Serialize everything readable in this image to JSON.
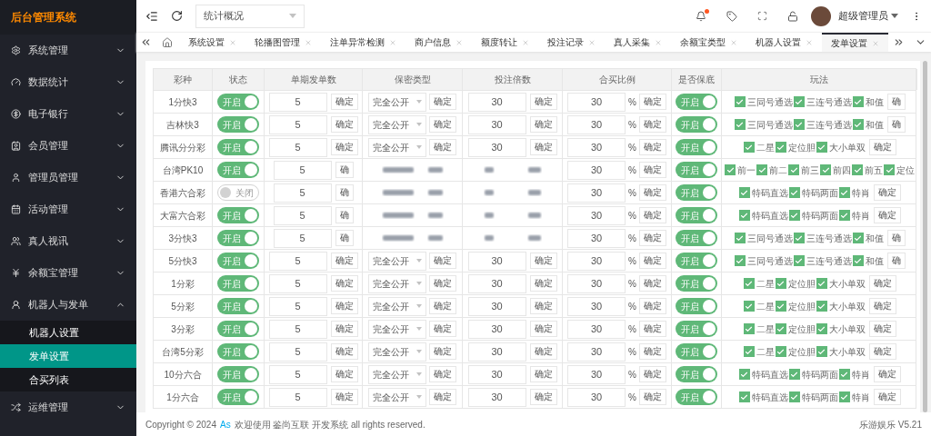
{
  "logo": "后台管理系统",
  "sidebar": {
    "items": [
      {
        "label": "系统管理",
        "expanded": false
      },
      {
        "label": "数据统计",
        "expanded": false
      },
      {
        "label": "电子银行",
        "expanded": false
      },
      {
        "label": "会员管理",
        "expanded": false
      },
      {
        "label": "管理员管理",
        "expanded": false
      },
      {
        "label": "活动管理",
        "expanded": false
      },
      {
        "label": "真人视讯",
        "expanded": false
      },
      {
        "label": "余额宝管理",
        "expanded": false
      },
      {
        "label": "机器人与发单",
        "expanded": true,
        "children": [
          {
            "label": "机器人设置",
            "selected": false
          },
          {
            "label": "发单设置",
            "selected": true
          },
          {
            "label": "合买列表",
            "selected": false
          }
        ]
      },
      {
        "label": "运维管理",
        "expanded": false
      }
    ]
  },
  "topbar": {
    "select": "统计概况",
    "user": "超级管理员",
    "notification_dot": true
  },
  "tabs": [
    {
      "label": "系统设置",
      "selected": false
    },
    {
      "label": "轮播图管理",
      "selected": false
    },
    {
      "label": "注单异常检测",
      "selected": false
    },
    {
      "label": "商户信息",
      "selected": false
    },
    {
      "label": "额度转让",
      "selected": false
    },
    {
      "label": "投注记录",
      "selected": false
    },
    {
      "label": "真人采集",
      "selected": false
    },
    {
      "label": "余额宝类型",
      "selected": false
    },
    {
      "label": "机器人设置",
      "selected": false
    },
    {
      "label": "发单设置",
      "selected": true
    }
  ],
  "table": {
    "columns": [
      "彩种",
      "状态",
      "单期发单数",
      "保密类型",
      "投注倍数",
      "合买比例",
      "是否保底",
      "玩法"
    ],
    "rows": [
      {
        "name": "1分快3",
        "status": {
          "on": true,
          "label": "开启"
        },
        "qty": "5",
        "qty_button": "确定",
        "blurred": false,
        "secrecy": "完全公开",
        "secrecy_button": "确定",
        "multiple": "30",
        "multiple_button": "确定",
        "ratio": "30",
        "ratio_unit": "%",
        "ratio_button": "确定",
        "guarantee": {
          "on": true,
          "label": "开启"
        },
        "plays": [
          {
            "label": "三同号通选",
            "checked": true
          },
          {
            "label": "三连号通选",
            "checked": true
          },
          {
            "label": "和值",
            "checked": true
          }
        ],
        "plays_button": "确"
      },
      {
        "name": "吉林快3",
        "status": {
          "on": true,
          "label": "开启"
        },
        "qty": "5",
        "qty_button": "确定",
        "blurred": false,
        "secrecy": "完全公开",
        "secrecy_button": "确定",
        "multiple": "30",
        "multiple_button": "确定",
        "ratio": "30",
        "ratio_unit": "%",
        "ratio_button": "确定",
        "guarantee": {
          "on": true,
          "label": "开启"
        },
        "plays": [
          {
            "label": "三同号通选",
            "checked": true
          },
          {
            "label": "三连号通选",
            "checked": true
          },
          {
            "label": "和值",
            "checked": true
          }
        ],
        "plays_button": "确"
      },
      {
        "name": "腾讯分分彩",
        "status": {
          "on": true,
          "label": "开启"
        },
        "qty": "5",
        "qty_button": "确定",
        "blurred": false,
        "secrecy": "完全公开",
        "secrecy_button": "确定",
        "multiple": "30",
        "multiple_button": "确定",
        "ratio": "30",
        "ratio_unit": "%",
        "ratio_button": "确定",
        "guarantee": {
          "on": true,
          "label": "开启"
        },
        "plays": [
          {
            "label": "二星",
            "checked": true
          },
          {
            "label": "定位胆",
            "checked": true
          },
          {
            "label": "大小单双",
            "checked": true
          }
        ],
        "plays_button": "确定"
      },
      {
        "name": "台湾PK10",
        "status": {
          "on": true,
          "label": "开启"
        },
        "qty": "5",
        "qty_button": "确",
        "blurred": true,
        "ratio": "30",
        "ratio_unit": "%",
        "ratio_button": "确定",
        "guarantee": {
          "on": true,
          "label": "开启"
        },
        "plays": [
          {
            "label": "前一",
            "checked": true
          },
          {
            "label": "前二",
            "checked": true
          },
          {
            "label": "前三",
            "checked": true
          },
          {
            "label": "前四",
            "checked": true
          },
          {
            "label": "前五",
            "checked": true
          },
          {
            "label": "定位",
            "checked": true
          }
        ]
      },
      {
        "name": "香港六合彩",
        "status": {
          "on": false,
          "label": "关闭"
        },
        "qty": "5",
        "qty_button": "确",
        "blurred": true,
        "ratio": "30",
        "ratio_unit": "%",
        "ratio_button": "确定",
        "guarantee": {
          "on": true,
          "label": "开启"
        },
        "plays": [
          {
            "label": "特码直选",
            "checked": true
          },
          {
            "label": "特码两面",
            "checked": true
          },
          {
            "label": "特肖",
            "checked": true
          }
        ],
        "plays_button": "确定"
      },
      {
        "name": "大富六合彩",
        "status": {
          "on": true,
          "label": "开启"
        },
        "qty": "5",
        "qty_button": "确",
        "blurred": true,
        "ratio": "30",
        "ratio_unit": "%",
        "ratio_button": "确定",
        "guarantee": {
          "on": true,
          "label": "开启"
        },
        "plays": [
          {
            "label": "特码直选",
            "checked": true
          },
          {
            "label": "特码两面",
            "checked": true
          },
          {
            "label": "特肖",
            "checked": true
          }
        ],
        "plays_button": "确定"
      },
      {
        "name": "3分快3",
        "status": {
          "on": true,
          "label": "开启"
        },
        "qty": "5",
        "qty_button": "确",
        "blurred": true,
        "ratio": "30",
        "ratio_unit": "%",
        "ratio_button": "确定",
        "guarantee": {
          "on": true,
          "label": "开启"
        },
        "plays": [
          {
            "label": "三同号通选",
            "checked": true
          },
          {
            "label": "三连号通选",
            "checked": true
          },
          {
            "label": "和值",
            "checked": true
          }
        ],
        "plays_button": "确"
      },
      {
        "name": "5分快3",
        "status": {
          "on": true,
          "label": "开启"
        },
        "qty": "5",
        "qty_button": "确定",
        "blurred": false,
        "secrecy": "完全公开",
        "secrecy_button": "确定",
        "multiple": "30",
        "multiple_button": "确定",
        "ratio": "30",
        "ratio_unit": "%",
        "ratio_button": "确定",
        "guarantee": {
          "on": true,
          "label": "开启"
        },
        "plays": [
          {
            "label": "三同号通选",
            "checked": true
          },
          {
            "label": "三连号通选",
            "checked": true
          },
          {
            "label": "和值",
            "checked": true
          }
        ],
        "plays_button": "确"
      },
      {
        "name": "1分彩",
        "status": {
          "on": true,
          "label": "开启"
        },
        "qty": "5",
        "qty_button": "确定",
        "blurred": false,
        "secrecy": "完全公开",
        "secrecy_button": "确定",
        "multiple": "30",
        "multiple_button": "确定",
        "ratio": "30",
        "ratio_unit": "%",
        "ratio_button": "确定",
        "guarantee": {
          "on": true,
          "label": "开启"
        },
        "plays": [
          {
            "label": "二星",
            "checked": true
          },
          {
            "label": "定位胆",
            "checked": true
          },
          {
            "label": "大小单双",
            "checked": true
          }
        ],
        "plays_button": "确定"
      },
      {
        "name": "5分彩",
        "status": {
          "on": true,
          "label": "开启"
        },
        "qty": "5",
        "qty_button": "确定",
        "blurred": false,
        "secrecy": "完全公开",
        "secrecy_button": "确定",
        "multiple": "30",
        "multiple_button": "确定",
        "ratio": "30",
        "ratio_unit": "%",
        "ratio_button": "确定",
        "guarantee": {
          "on": true,
          "label": "开启"
        },
        "plays": [
          {
            "label": "二星",
            "checked": true
          },
          {
            "label": "定位胆",
            "checked": true
          },
          {
            "label": "大小单双",
            "checked": true
          }
        ],
        "plays_button": "确定"
      },
      {
        "name": "3分彩",
        "status": {
          "on": true,
          "label": "开启"
        },
        "qty": "5",
        "qty_button": "确定",
        "blurred": false,
        "secrecy": "完全公开",
        "secrecy_button": "确定",
        "multiple": "30",
        "multiple_button": "确定",
        "ratio": "30",
        "ratio_unit": "%",
        "ratio_button": "确定",
        "guarantee": {
          "on": true,
          "label": "开启"
        },
        "plays": [
          {
            "label": "二星",
            "checked": true
          },
          {
            "label": "定位胆",
            "checked": true
          },
          {
            "label": "大小单双",
            "checked": true
          }
        ],
        "plays_button": "确定"
      },
      {
        "name": "台湾5分彩",
        "status": {
          "on": true,
          "label": "开启"
        },
        "qty": "5",
        "qty_button": "确定",
        "blurred": false,
        "secrecy": "完全公开",
        "secrecy_button": "确定",
        "multiple": "30",
        "multiple_button": "确定",
        "ratio": "30",
        "ratio_unit": "%",
        "ratio_button": "确定",
        "guarantee": {
          "on": true,
          "label": "开启"
        },
        "plays": [
          {
            "label": "二星",
            "checked": true
          },
          {
            "label": "定位胆",
            "checked": true
          },
          {
            "label": "大小单双",
            "checked": true
          }
        ],
        "plays_button": "确定"
      },
      {
        "name": "10分六合",
        "status": {
          "on": true,
          "label": "开启"
        },
        "qty": "5",
        "qty_button": "确定",
        "blurred": false,
        "secrecy": "完全公开",
        "secrecy_button": "确定",
        "multiple": "30",
        "multiple_button": "确定",
        "ratio": "30",
        "ratio_unit": "%",
        "ratio_button": "确定",
        "guarantee": {
          "on": true,
          "label": "开启"
        },
        "plays": [
          {
            "label": "特码直选",
            "checked": true
          },
          {
            "label": "特码两面",
            "checked": true
          },
          {
            "label": "特肖",
            "checked": true
          }
        ],
        "plays_button": "确定"
      },
      {
        "name": "1分六合",
        "status": {
          "on": true,
          "label": "开启"
        },
        "qty": "5",
        "qty_button": "确定",
        "blurred": false,
        "secrecy": "完全公开",
        "secrecy_button": "确定",
        "multiple": "30",
        "multiple_button": "确定",
        "ratio": "30",
        "ratio_unit": "%",
        "ratio_button": "确定",
        "guarantee": {
          "on": true,
          "label": "开启"
        },
        "plays": [
          {
            "label": "特码直选",
            "checked": true
          },
          {
            "label": "特码两面",
            "checked": true
          },
          {
            "label": "特肖",
            "checked": true
          }
        ],
        "plays_button": "确定"
      }
    ]
  },
  "footer": {
    "before": "Copyright © 2024",
    "link": "As",
    "after": "欢迎使用 鉴尚互联 开发系统 all rights reserved.",
    "version": "乐游娱乐 V5.21"
  }
}
